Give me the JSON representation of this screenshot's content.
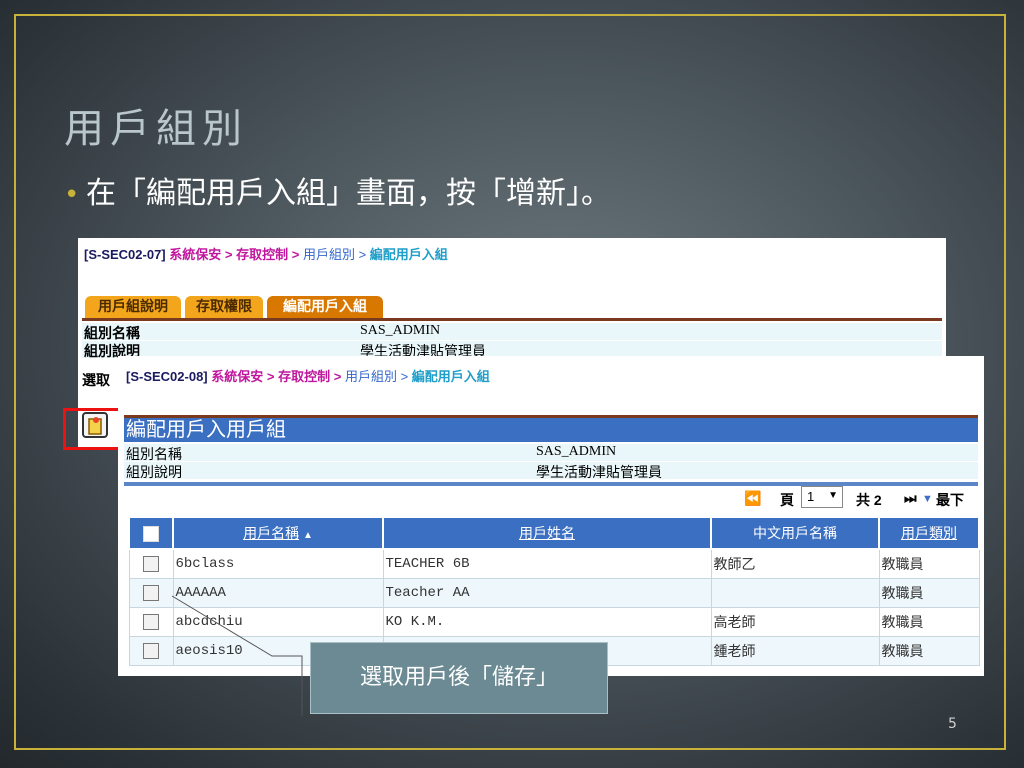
{
  "slide": {
    "title": "用戶組別",
    "bullet": "在「編配用戶入組」畫面，按「增新」。",
    "page_number": "5",
    "callout": "選取用戶後「儲存」"
  },
  "screen1": {
    "code": "[S-SEC02-07]",
    "crumb_1": "系統保安",
    "crumb_sep1": " > ",
    "crumb_2": "存取控制",
    "crumb_sep2": " > ",
    "crumb_3": "用戶組別",
    "crumb_sep3": " > ",
    "crumb_4": "編配用戶入組",
    "tabs": [
      "用戶組說明",
      "存取權限",
      "編配用戶入組"
    ],
    "group_name_label": "組別名稱",
    "group_name_value": "SAS_ADMIN",
    "group_desc_label": "組別說明",
    "group_desc_value": "學生活動津貼管理員",
    "select_label": "選取"
  },
  "screen2": {
    "code": "[S-SEC02-08]",
    "crumb_1": "系統保安",
    "crumb_sep1": " > ",
    "crumb_2": "存取控制",
    "crumb_sep2": " > ",
    "crumb_3": "用戶組別",
    "crumb_sep3": " > ",
    "crumb_4": "編配用戶入組",
    "panel_title": "編配用戶入用戶組",
    "group_name_label": "組別名稱",
    "group_name_value": "SAS_ADMIN",
    "group_desc_label": "組別說明",
    "group_desc_value": "學生活動津貼管理員",
    "pager": {
      "page_label": "頁",
      "page_value": "1",
      "total_label": "共",
      "total_value": "2",
      "last_label": "最下"
    },
    "columns": [
      "用戶名稱",
      "用戶姓名",
      "中文用戶名稱",
      "用戶類別"
    ],
    "rows": [
      {
        "login": "6bclass",
        "name": "TEACHER 6B",
        "cname": "教師乙",
        "type": "教職員"
      },
      {
        "login": "AAAAAA",
        "name": "Teacher AA",
        "cname": "",
        "type": "教職員"
      },
      {
        "login": "abcdchiu",
        "name": "KO K.M.",
        "cname": "高老師",
        "type": "教職員"
      },
      {
        "login": "aeosis10",
        "name": "",
        "cname": "鍾老師",
        "type": "教職員"
      }
    ]
  }
}
